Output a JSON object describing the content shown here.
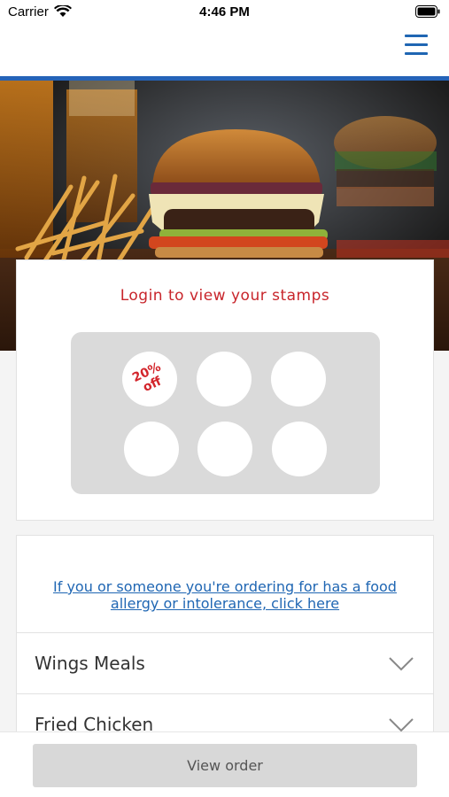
{
  "status_bar": {
    "carrier": "Carrier",
    "time": "4:46 PM",
    "wifi_icon": "wifi-icon",
    "battery_icon": "battery-icon"
  },
  "header": {
    "menu_icon": "hamburger-menu-icon",
    "accent_color": "#2563b8"
  },
  "hero": {
    "image": "burger-and-fries-photo"
  },
  "stamps": {
    "title": "Login to view your stamps",
    "title_color": "#c8252b",
    "offer_line1": "20%",
    "offer_line2": "off",
    "total_stamps": 6
  },
  "allergy": {
    "link_text": "If you or someone you're ordering for has a food allergy or intolerance, click here"
  },
  "menu_categories": [
    {
      "label": "Wings Meals"
    },
    {
      "label": "Fried Chicken"
    }
  ],
  "footer": {
    "view_order_label": "View order"
  }
}
